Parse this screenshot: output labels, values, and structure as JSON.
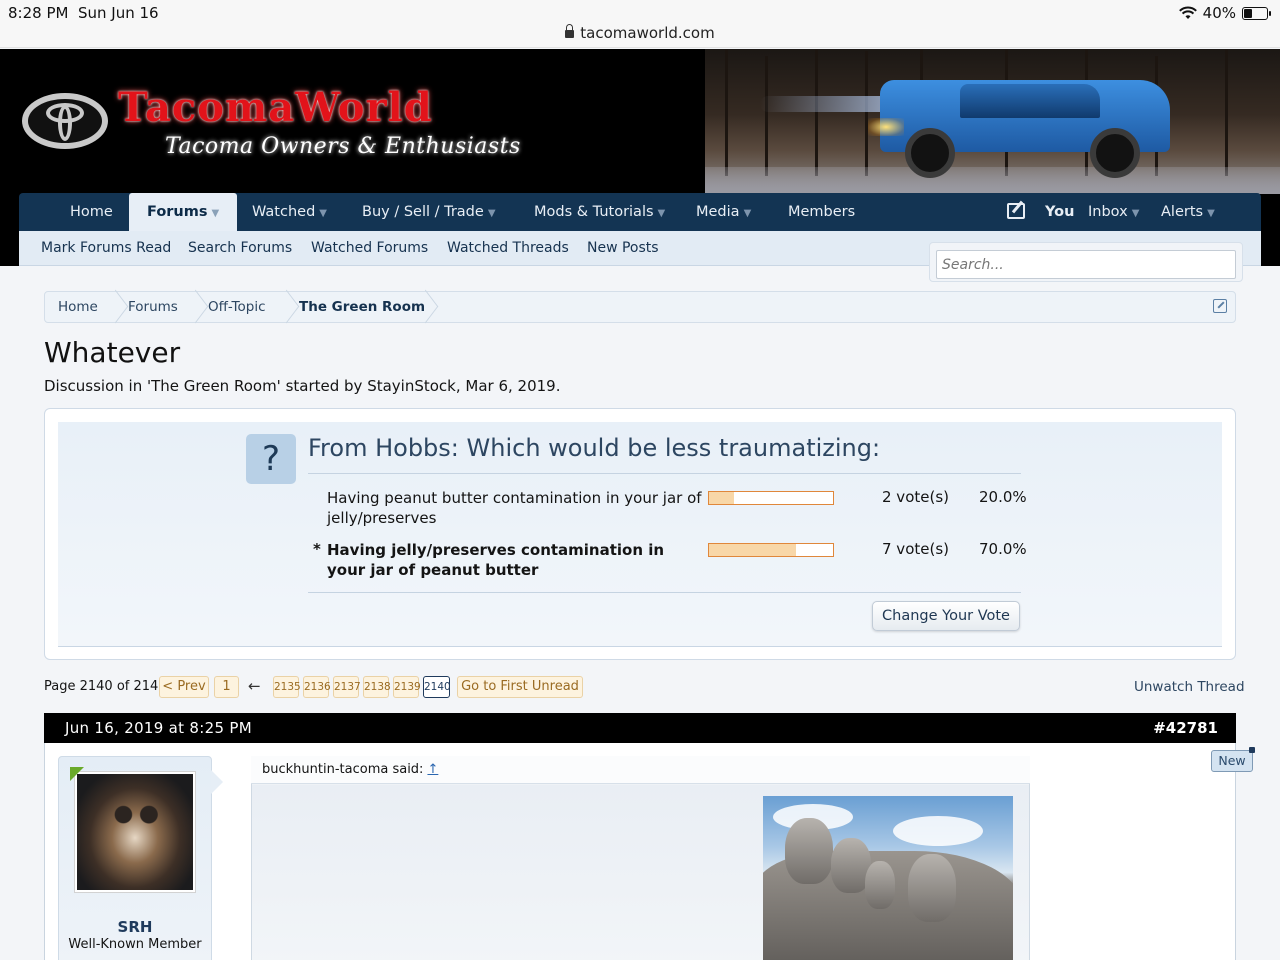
{
  "status_bar": {
    "time": "8:28 PM",
    "date": "Sun Jun 16",
    "battery": "40%",
    "battery_level": 0.4,
    "url": "tacomaworld.com"
  },
  "brand": {
    "title": "TacomaWorld",
    "tagline": "Tacoma Owners & Enthusiasts"
  },
  "nav": {
    "items": [
      {
        "label": "Home"
      },
      {
        "label": "Forums",
        "active": true,
        "dropdown": true
      },
      {
        "label": "Watched",
        "dropdown": true
      },
      {
        "label": "Buy / Sell / Trade",
        "dropdown": true
      },
      {
        "label": "Mods & Tutorials",
        "dropdown": true
      },
      {
        "label": "Media",
        "dropdown": true
      },
      {
        "label": "Members"
      }
    ],
    "right": {
      "compose_icon": "pencil-square-icon",
      "you": "You",
      "inbox": "Inbox",
      "alerts": "Alerts"
    }
  },
  "subnav": {
    "items": [
      "Mark Forums Read",
      "Search Forums",
      "Watched Forums",
      "Watched Threads",
      "New Posts"
    ]
  },
  "search": {
    "placeholder": "Search..."
  },
  "breadcrumb": [
    "Home",
    "Forums",
    "Off-Topic",
    "The Green Room"
  ],
  "thread": {
    "title": "Whatever",
    "description": "Discussion in 'The Green Room' started by StayinStock, Mar 6, 2019."
  },
  "poll": {
    "icon": "?",
    "question": "From Hobbs: Which would be less traumatizing:",
    "options": [
      {
        "text": "Having peanut butter contamination in your jar of jelly/preserves",
        "votes": "2 vote(s)",
        "percent": "20.0%",
        "fraction": 0.2,
        "voted": false
      },
      {
        "text": "Having jelly/preserves contamination in your jar of peanut butter",
        "votes": "7 vote(s)",
        "percent": "70.0%",
        "fraction": 0.7,
        "voted": true
      }
    ],
    "voted_marker": "*",
    "change_vote_label": "Change Your Vote"
  },
  "pagination": {
    "label": "Page 2140 of 2140",
    "prev": "< Prev",
    "first": "1",
    "ellipsis_arrow": "←",
    "pages": [
      "2135",
      "2136",
      "2137",
      "2138",
      "2139",
      "2140"
    ],
    "current": "2140",
    "go_first_unread": "Go to First Unread",
    "unwatch": "Unwatch Thread"
  },
  "post": {
    "date": "Jun 16, 2019 at 8:25 PM",
    "number": "#42781",
    "new_badge": "New",
    "user": {
      "name": "SRH",
      "title": "Well-Known Member"
    },
    "quote": {
      "author": "buckhuntin-tacoma said:",
      "up_link": "↑"
    }
  }
}
